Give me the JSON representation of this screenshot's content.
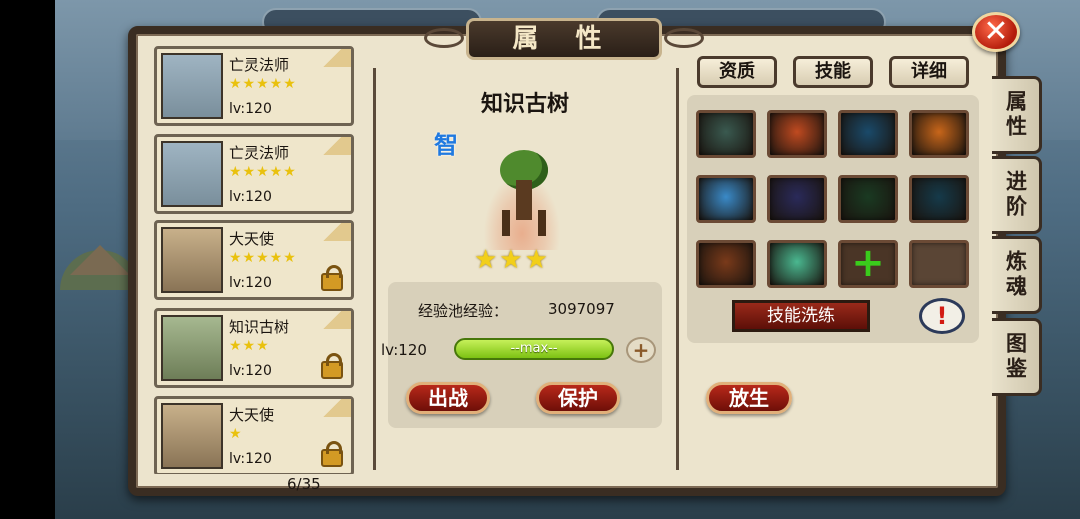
{
  "window": {
    "title": "属 性"
  },
  "side_tabs": [
    "属性",
    "进阶",
    "炼魂",
    "图鉴"
  ],
  "hero_list": [
    {
      "name": "亡灵法师",
      "stars": 5,
      "level": "lv:120",
      "locked": false,
      "portrait": "undead-mage"
    },
    {
      "name": "亡灵法师",
      "stars": 5,
      "level": "lv:120",
      "locked": false,
      "portrait": "undead-mage"
    },
    {
      "name": "大天使",
      "stars": 5,
      "level": "lv:120",
      "locked": true,
      "portrait": "archangel"
    },
    {
      "name": "知识古树",
      "stars": 3,
      "level": "lv:120",
      "locked": true,
      "portrait": "ancient-tree"
    },
    {
      "name": "大天使",
      "stars": 1,
      "level": "lv:120",
      "locked": true,
      "portrait": "archangel"
    }
  ],
  "page_count": "6/35",
  "selected_hero": {
    "name": "知识古树",
    "attribute": "智",
    "stars": 3,
    "exp_label": "经验池经验：",
    "exp_value": "3097097",
    "level": "lv:120",
    "level_bar_text": "--max--",
    "level_progress": 1.0
  },
  "buttons": {
    "deploy": "出战",
    "protect": "保护",
    "release": "放生",
    "skill_refine": "技能洗练",
    "info": "!",
    "close": "✕",
    "add_exp": "+"
  },
  "right_tabs": [
    "资质",
    "技能",
    "详细"
  ],
  "skills": [
    {
      "icon": "warrior-group-icon",
      "color": "#3a5a50"
    },
    {
      "icon": "fist-flash-icon",
      "color": "#c04a20"
    },
    {
      "icon": "blue-spirit-icon",
      "color": "#1a4a6a"
    },
    {
      "icon": "fire-orb-icon",
      "color": "#c8661a"
    },
    {
      "icon": "ice-crystal-icon",
      "color": "#3a8ac8"
    },
    {
      "icon": "light-beam-icon",
      "color": "#2a2a5a"
    },
    {
      "icon": "green-sparkle-icon",
      "color": "#1a3a22"
    },
    {
      "icon": "lightning-icon",
      "color": "#153a4a"
    },
    {
      "icon": "flame-claw-icon",
      "color": "#7a3a1a"
    },
    {
      "icon": "green-aura-icon",
      "color": "#4ab890"
    },
    {
      "icon": "add-skill-icon",
      "color": "#4a3526"
    },
    {
      "icon": "empty-slot",
      "color": "#5a4535"
    }
  ]
}
